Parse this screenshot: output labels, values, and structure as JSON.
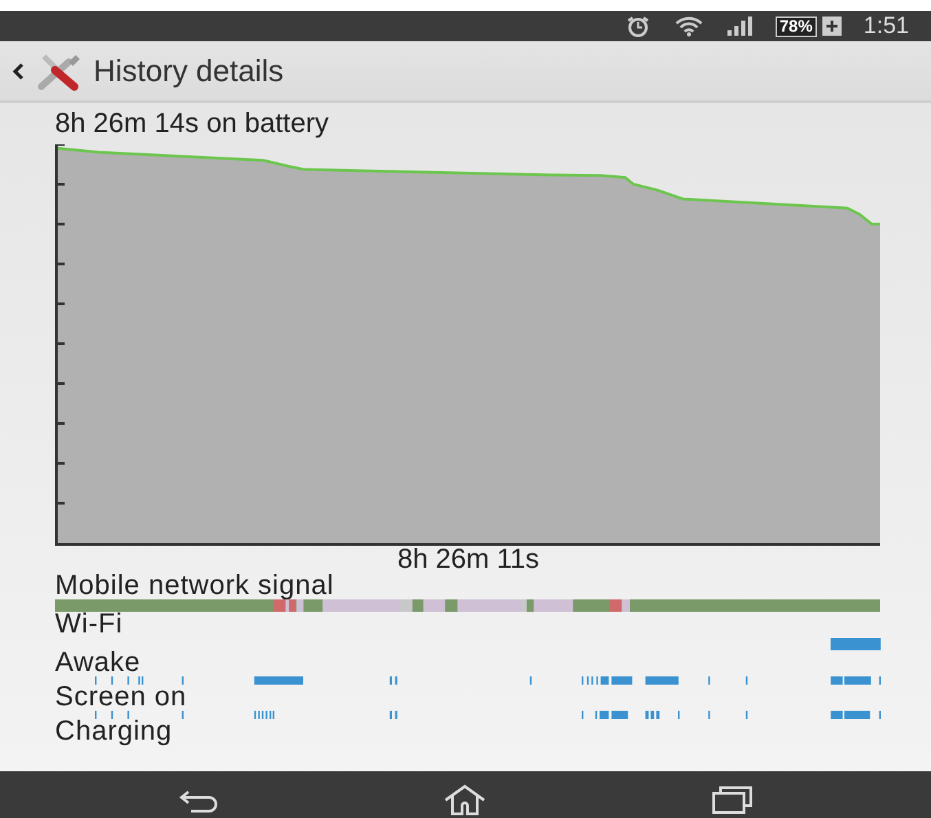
{
  "status_bar": {
    "battery": "78%",
    "time": "1:51"
  },
  "header": {
    "title": "History details"
  },
  "battery_summary": "8h 26m 14s on battery",
  "chart_caption": "8h 26m 11s",
  "timelines": [
    {
      "label": "Mobile network signal",
      "kind": "signal"
    },
    {
      "label": "Wi-Fi",
      "kind": "wifi"
    },
    {
      "label": "Awake",
      "kind": "awake"
    },
    {
      "label": "Screen on",
      "kind": "screen"
    },
    {
      "label": "Charging",
      "kind": "charging"
    }
  ]
}
